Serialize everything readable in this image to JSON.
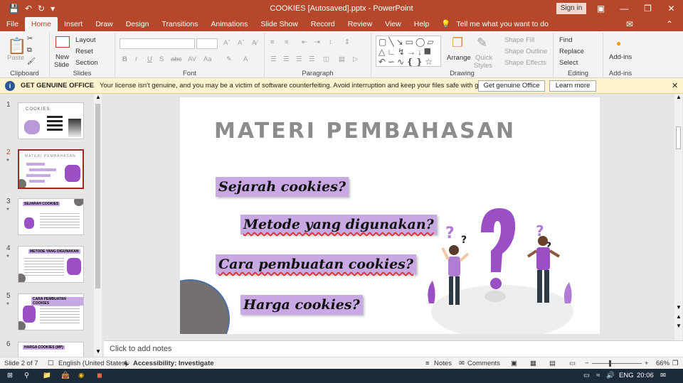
{
  "window": {
    "title": "COOKIES [Autosaved].pptx  -  PowerPoint",
    "sign_in": "Sign in"
  },
  "tabs": [
    "File",
    "Home",
    "Insert",
    "Draw",
    "Design",
    "Transitions",
    "Animations",
    "Slide Show",
    "Record",
    "Review",
    "View",
    "Help"
  ],
  "tell_me": "Tell me what you want to do",
  "ribbon": {
    "clipboard": {
      "label": "Clipboard",
      "paste": "Paste"
    },
    "slides": {
      "label": "Slides",
      "new_slide": "New",
      "new_slide2": "Slide",
      "layout": "Layout",
      "reset": "Reset",
      "section": "Section"
    },
    "font": {
      "label": "Font"
    },
    "paragraph": {
      "label": "Paragraph"
    },
    "drawing": {
      "label": "Drawing",
      "arrange": "Arrange",
      "quick_styles": "Quick",
      "quick_styles2": "Styles",
      "shape_fill": "Shape Fill",
      "shape_outline": "Shape Outline",
      "shape_effects": "Shape Effects"
    },
    "editing": {
      "label": "Editing",
      "find": "Find",
      "replace": "Replace",
      "select": "Select"
    },
    "addins": {
      "label": "Add-ins",
      "button": "Add-ins"
    }
  },
  "notice": {
    "title": "GET GENUINE OFFICE",
    "message": "Your license isn't genuine, and you may be a victim of software counterfeiting. Avoid interruption and keep your files safe with genuine Office today.",
    "button_get": "Get genuine Office",
    "button_learn": "Learn more"
  },
  "thumbnails": [
    {
      "num": "1",
      "text": "COOKIES"
    },
    {
      "num": "2",
      "text": "MATERI PEMBAHASAN"
    },
    {
      "num": "3",
      "text": "SEJARAH COOKIES"
    },
    {
      "num": "4",
      "text": "METODE YANG DIGUNAKAN"
    },
    {
      "num": "5",
      "text": "CARA PEMBUATAN COOKIES"
    },
    {
      "num": "6",
      "text": "HARGA COOKIES (MP)"
    }
  ],
  "slide": {
    "title": "MATERI PEMBAHASAN",
    "items": [
      "Sejarah cookies?",
      "Metode yang digunakan?",
      "Cara pembuatan cookies?",
      "Harga cookies?"
    ],
    "colors": {
      "pill": "#c9a9e4",
      "purple": "#9b4fc4",
      "gray": "#747070"
    }
  },
  "notes_placeholder": "Click to add notes",
  "status": {
    "slide_of": "Slide 2 of 7",
    "language": "English (United States)",
    "accessibility": "Accessibility: Investigate",
    "notes": "Notes",
    "comments": "Comments",
    "zoom": "66%"
  },
  "taskbar": {
    "lang": "ENG",
    "time": "20:06"
  }
}
